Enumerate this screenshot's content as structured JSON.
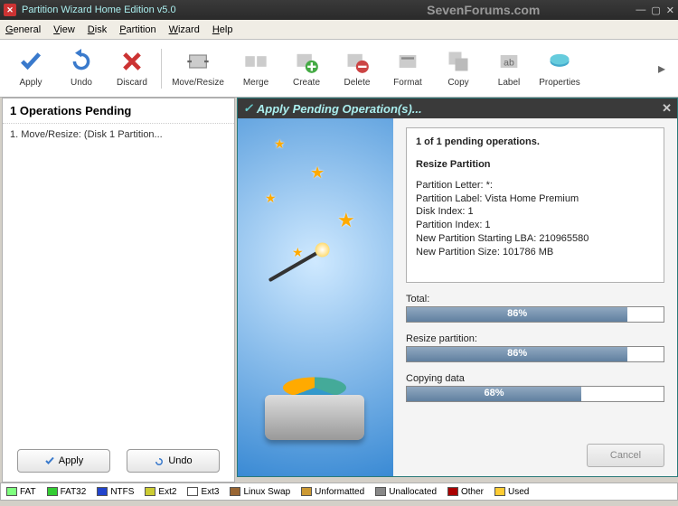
{
  "window": {
    "title": "Partition Wizard Home Edition v5.0",
    "watermark": "SevenForums.com"
  },
  "menu": {
    "general": "General",
    "view": "View",
    "disk": "Disk",
    "partition": "Partition",
    "wizard": "Wizard",
    "help": "Help"
  },
  "toolbar": {
    "apply": "Apply",
    "undo": "Undo",
    "discard": "Discard",
    "move_resize": "Move/Resize",
    "merge": "Merge",
    "create": "Create",
    "delete": "Delete",
    "format": "Format",
    "copy": "Copy",
    "label": "Label",
    "properties": "Properties"
  },
  "operations": {
    "heading": "1 Operations Pending",
    "items": [
      "1. Move/Resize: (Disk 1 Partition..."
    ],
    "apply_btn": "Apply",
    "undo_btn": "Undo"
  },
  "dialog": {
    "title": "Apply Pending Operation(s)...",
    "summary": "1 of 1 pending operations.",
    "op_title": "Resize Partition",
    "lines": [
      "Partition Letter: *:",
      "Partition Label: Vista Home Premium",
      "Disk Index: 1",
      "Partition Index: 1",
      "New Partition Starting LBA: 210965580",
      "New Partition Size: 101786 MB"
    ],
    "progress": [
      {
        "label": "Total:",
        "pct": "86%",
        "value": 86
      },
      {
        "label": "Resize partition:",
        "pct": "86%",
        "value": 86
      },
      {
        "label": "Copying data",
        "pct": "68%",
        "value": 68
      }
    ],
    "cancel": "Cancel"
  },
  "legend": [
    {
      "label": "FAT",
      "color": "#7fff7f"
    },
    {
      "label": "FAT32",
      "color": "#33cc33"
    },
    {
      "label": "NTFS",
      "color": "#2244cc"
    },
    {
      "label": "Ext2",
      "color": "#cccc33"
    },
    {
      "label": "Ext3",
      "color": "#ffffff"
    },
    {
      "label": "Linux Swap",
      "color": "#996633"
    },
    {
      "label": "Unformatted",
      "color": "#cc9933"
    },
    {
      "label": "Unallocated",
      "color": "#888888"
    },
    {
      "label": "Other",
      "color": "#aa0000"
    },
    {
      "label": "Used",
      "color": "#ffcc33"
    }
  ]
}
